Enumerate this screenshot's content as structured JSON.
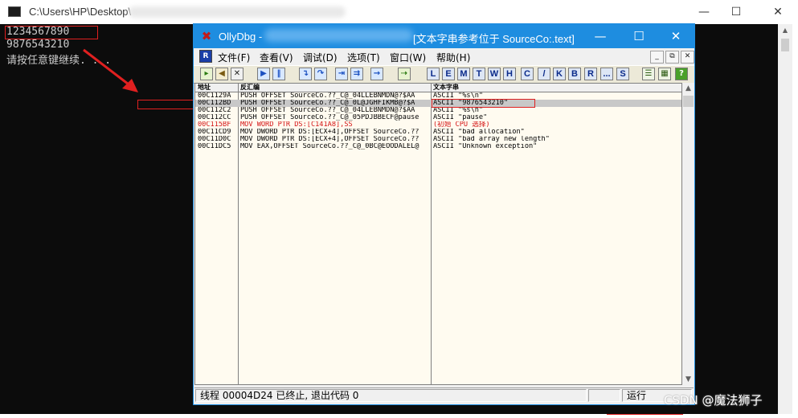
{
  "console": {
    "title": "C:\\Users\\HP\\Desktop\\",
    "controls": {
      "minimize": "—",
      "maximize": "☐",
      "close": "✕"
    },
    "lines": [
      "1234567890",
      "9876543210",
      "请按任意键继续. . ."
    ]
  },
  "olly": {
    "app_name": "OllyDbg -",
    "window_subtitle": "[文本字串参考位于 SourceCo:.text]",
    "controls": {
      "minimize": "—",
      "maximize": "☐",
      "close": "✕"
    },
    "menu": [
      {
        "label": "文件(F)"
      },
      {
        "label": "查看(V)"
      },
      {
        "label": "调试(D)"
      },
      {
        "label": "选项(T)"
      },
      {
        "label": "窗口(W)"
      },
      {
        "label": "帮助(H)"
      }
    ],
    "mdi_controls": [
      "_",
      "⧉",
      "✕"
    ],
    "toolbar_letters": [
      "L",
      "E",
      "M",
      "T",
      "W",
      "H",
      "C",
      "/",
      "K",
      "B",
      "R",
      "...",
      "S"
    ],
    "columns": {
      "address": "地址",
      "disassembly": "反汇编",
      "text": "文本字串"
    },
    "rows": [
      {
        "address": "00C1129A",
        "disasm": "PUSH OFFSET SourceCo.??_C@_04LLEBNMDN@?$AA",
        "text": "ASCII \"%s\\n\"",
        "style": "normal"
      },
      {
        "address": "00C112BD",
        "disasm": "PUSH OFFSET SourceCo.??_C@_0L@JGHFIKMB@?$A",
        "text": "ASCII \"9876543210\"",
        "style": "selected"
      },
      {
        "address": "00C112C2",
        "disasm": "PUSH OFFSET SourceCo.??_C@_04LLEBNMDN@?$AA",
        "text": "ASCII \"%s\\n\"",
        "style": "normal"
      },
      {
        "address": "00C112CC",
        "disasm": "PUSH OFFSET SourceCo.??_C@_05PDJBBECF@pause",
        "text": "ASCII \"pause\"",
        "style": "normal"
      },
      {
        "address": "00C115BF",
        "disasm": "MOV WORD PTR DS:[C141A8],SS",
        "text": "(初始 CPU 选择)",
        "style": "red"
      },
      {
        "address": "00C11CD9",
        "disasm": "MOV DWORD PTR DS:[ECX+4],OFFSET SourceCo.??",
        "text": "ASCII \"bad allocation\"",
        "style": "normal"
      },
      {
        "address": "00C11D0C",
        "disasm": "MOV DWORD PTR DS:[ECX+4],OFFSET SourceCo.??",
        "text": "ASCII \"bad array new length\"",
        "style": "normal"
      },
      {
        "address": "00C11DC5",
        "disasm": "MOV EAX,OFFSET SourceCo.??_C@_0BC@EOODALEL@",
        "text": "ASCII \"Unknown exception\"",
        "style": "normal"
      }
    ],
    "status": {
      "message": "线程 00004D24 已终止, 退出代码 0",
      "state": "运行"
    }
  },
  "watermark": "CSDN @魔法狮子",
  "colors": {
    "olly_title": "#1e8de0",
    "highlight_box": "#e02020",
    "console_bg": "#0c0c0c",
    "red_text": "#d41414"
  }
}
